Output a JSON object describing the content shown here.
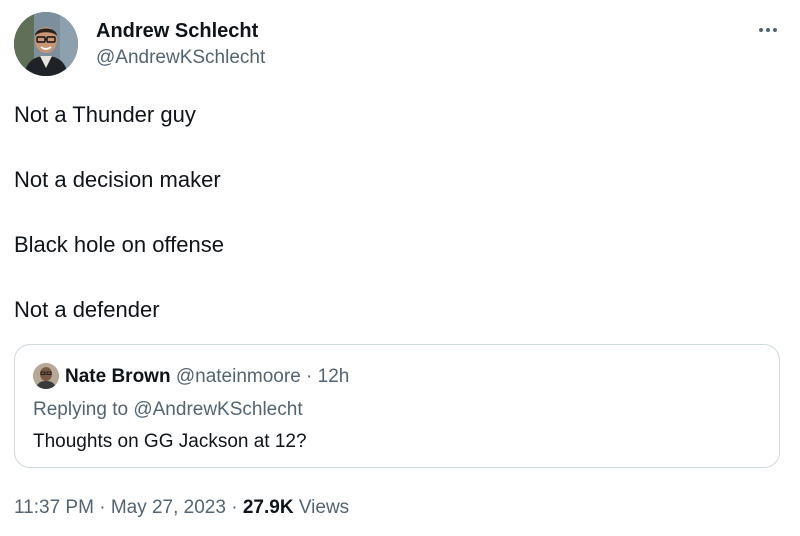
{
  "author": {
    "name": "Andrew Schlecht",
    "handle": "@AndrewKSchlecht",
    "more_icon": "more-horizontal-icon"
  },
  "tweet": {
    "lines": [
      "Not a Thunder guy",
      "Not a decision maker",
      "Black hole on offense",
      "Not a defender"
    ]
  },
  "quote": {
    "name": "Nate Brown",
    "handle": "@nateinmoore",
    "separator": " · ",
    "time": "12h",
    "replying_prefix": "Replying to ",
    "replying_handle": "@AndrewKSchlecht",
    "text": "Thoughts on GG Jackson at 12?"
  },
  "footer": {
    "time": "11:37 PM",
    "separator": " · ",
    "date": "May 27, 2023",
    "separator2": " · ",
    "views_count": "27.9K",
    "views_label": " Views"
  },
  "colors": {
    "text": "#0f1419",
    "secondary": "#536471",
    "border": "#cfd9de"
  }
}
